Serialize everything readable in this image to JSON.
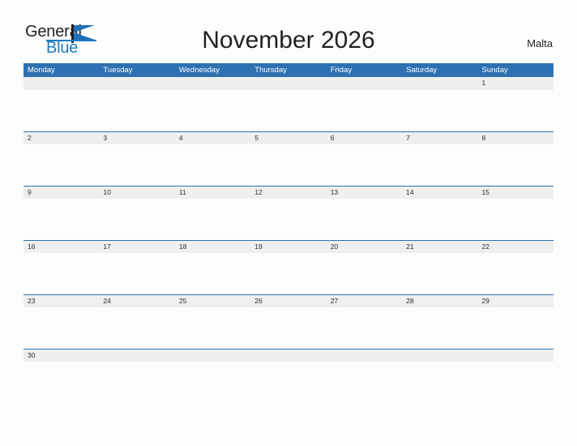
{
  "logo": {
    "word_one": "General",
    "word_two": "Blue",
    "flag_icon": "flag-triangle-icon"
  },
  "header": {
    "title": "November 2026",
    "region": "Malta"
  },
  "colors": {
    "header_blue": "#2e71b2",
    "logo_blue": "#1a7bc4",
    "date_band_gray": "#efefef",
    "text_dark": "#231f20",
    "page_background": "#fdfdfd"
  },
  "calendar": {
    "month": "November",
    "year": "2026",
    "week_start": "Monday",
    "day_headers": [
      "Monday",
      "Tuesday",
      "Wednesday",
      "Thursday",
      "Friday",
      "Saturday",
      "Sunday"
    ],
    "weeks": [
      [
        "",
        "",
        "",
        "",
        "",
        "",
        "1"
      ],
      [
        "2",
        "3",
        "4",
        "5",
        "6",
        "7",
        "8"
      ],
      [
        "9",
        "10",
        "11",
        "12",
        "13",
        "14",
        "15"
      ],
      [
        "16",
        "17",
        "18",
        "19",
        "20",
        "21",
        "22"
      ],
      [
        "23",
        "24",
        "25",
        "26",
        "27",
        "28",
        "29"
      ],
      [
        "30",
        "",
        "",
        "",
        "",
        "",
        ""
      ]
    ]
  }
}
